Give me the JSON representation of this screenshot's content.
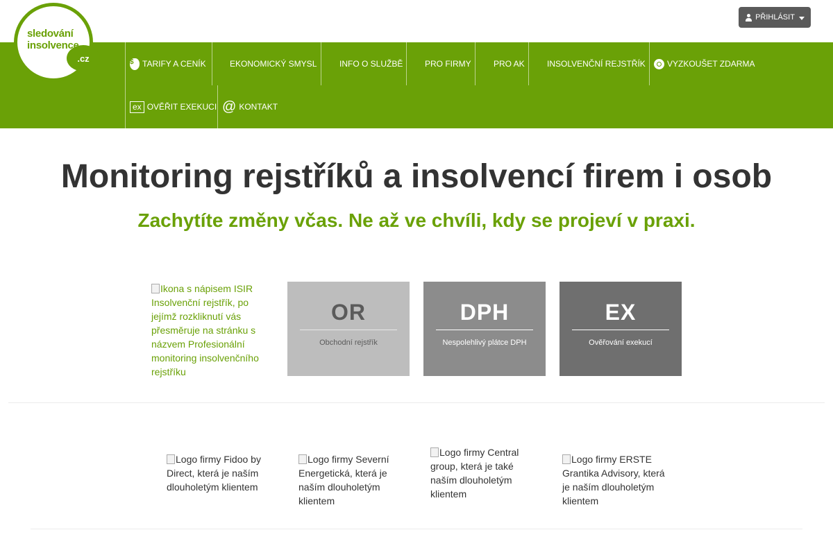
{
  "header": {
    "logo": {
      "line1": "sledování",
      "line2": "insolvence",
      "badge": ".cz"
    },
    "login_label": "PŘIHLÁSIT"
  },
  "nav": {
    "row1": [
      {
        "label": "TARIFY A CENÍK",
        "icon": "money-bag-icon"
      },
      {
        "label": "EKONOMICKÝ SMYSL"
      },
      {
        "label": "INFO O SLUŽBĚ"
      },
      {
        "label": "PRO FIRMY"
      },
      {
        "label": "PRO AK"
      },
      {
        "label": "INSOLVENČNÍ REJSTŘÍK"
      },
      {
        "label": "VYZKOUŠET ZDARMA",
        "icon": "search-icon"
      }
    ],
    "row2": [
      {
        "label": "OVĚŘIT EXEKUCI",
        "icon_text": "ex"
      },
      {
        "label": "KONTAKT",
        "icon_text": "@"
      }
    ]
  },
  "hero": {
    "title": "Monitoring rejstříků a insolvencí firem i osob",
    "subtitle": "Zachytíte změny včas. Ne až ve chvíli, kdy se projeví v praxi."
  },
  "tiles": {
    "isir_alt": "Ikona s nápisem ISIR Insolvenční rejstřík, po jejímž rozkliknutí vás přesměruje na stránku s názvem Profesionální monitoring insolvenčního rejstříku",
    "items": [
      {
        "code": "OR",
        "label": "Obchodní rejstřík"
      },
      {
        "code": "DPH",
        "label": "Nespolehlivý plátce DPH"
      },
      {
        "code": "EX",
        "label": "Ověřování exekucí"
      }
    ]
  },
  "clients": [
    "Logo firmy Fidoo by Direct, která je naším dlouholetým klientem",
    "Logo firmy Severní Energetická, která je naším dlouholetým klientem",
    "Logo firmy Central group, která je také naším dlouholetým klientem",
    "Logo firmy ERSTE Grantika Advisory, která je naším dlouholetým klientem"
  ],
  "colors": {
    "brand_green": "#6aa107",
    "login_bg": "#5a5a5a"
  }
}
